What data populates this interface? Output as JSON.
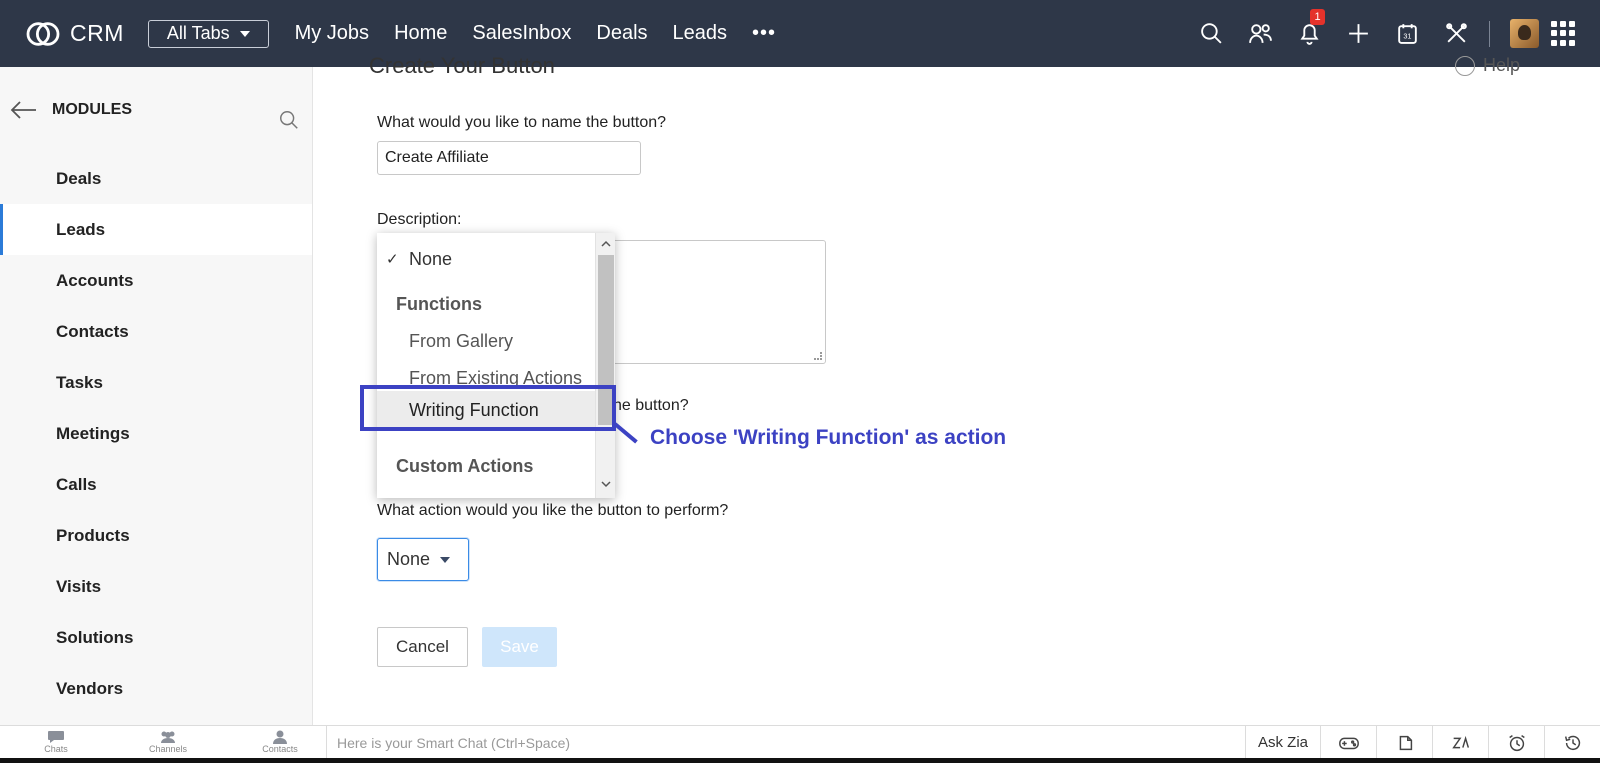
{
  "topbar": {
    "app_name": "CRM",
    "all_tabs_label": "All Tabs",
    "nav": [
      "My Jobs",
      "Home",
      "SalesInbox",
      "Deals",
      "Leads"
    ],
    "more_label": "•••",
    "notification_count": "1"
  },
  "sidebar": {
    "title": "MODULES",
    "items": [
      {
        "label": "Deals"
      },
      {
        "label": "Leads"
      },
      {
        "label": "Accounts"
      },
      {
        "label": "Contacts"
      },
      {
        "label": "Tasks"
      },
      {
        "label": "Meetings"
      },
      {
        "label": "Calls"
      },
      {
        "label": "Products"
      },
      {
        "label": "Visits"
      },
      {
        "label": "Solutions"
      },
      {
        "label": "Vendors"
      }
    ],
    "active_item": "Leads"
  },
  "main": {
    "page_title": "Create Your Button",
    "help_label": "Help",
    "name_question": "What would you like to name the button?",
    "name_value": "Create Affiliate",
    "description_label": "Description:",
    "placement_question_tail": "he button?",
    "action_question": "What action would you like the button to perform?",
    "action_selected": "None",
    "cancel_label": "Cancel",
    "save_label": "Save"
  },
  "dropdown": {
    "options": {
      "none": "None",
      "group_functions": "Functions",
      "from_gallery": "From Gallery",
      "from_existing": "From Existing Actions",
      "writing_function": "Writing Function",
      "group_custom": "Custom Actions"
    },
    "selected": "None",
    "check_mark": "✓"
  },
  "annotation": {
    "text": "Choose 'Writing Function' as action",
    "color": "#3c42c3"
  },
  "bottombar": {
    "chats": "Chats",
    "channels": "Channels",
    "contacts": "Contacts",
    "chat_placeholder": "Here is your Smart Chat (Ctrl+Space)",
    "ask_zia": "Ask Zia"
  },
  "colors": {
    "topbar_bg": "#2e3748",
    "accent": "#2b7bd8",
    "save_disabled": "#cfe6fb"
  }
}
